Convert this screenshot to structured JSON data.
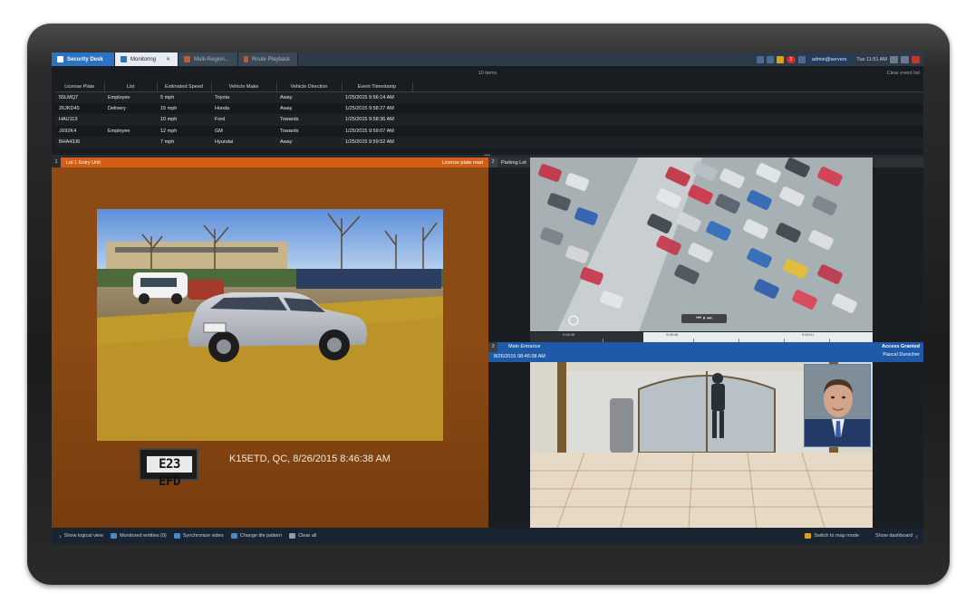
{
  "tabs": [
    {
      "label": "Security Desk"
    },
    {
      "label": "Monitoring"
    },
    {
      "label": "Multi-Region..."
    },
    {
      "label": "Route Playback"
    }
  ],
  "tray": {
    "alert_count": "3",
    "user": "admin@servers",
    "time": "Tue 11:51 AM"
  },
  "events": {
    "count_label": "10 items",
    "clear_label": "Clear event list",
    "columns": [
      "License Plate",
      "List",
      "Estimated Speed",
      "Vehicle Make",
      "Vehicle Direction",
      "Event Timestamp"
    ],
    "rows": [
      [
        "55LMQ7",
        "Employee",
        "5 mph",
        "Toyota",
        "Away",
        "1/25/2015 9:56:14 AM"
      ],
      [
        "26JKD45",
        "Delivery",
        "15 mph",
        "Honda",
        "Away",
        "1/25/2015 9:58:27 AM"
      ],
      [
        "HAU113",
        "",
        "10 mph",
        "Ford",
        "Towards",
        "1/25/2015 9:58:36 AM"
      ],
      [
        "JX92K4",
        "Employee",
        "12 mph",
        "GM",
        "Towards",
        "1/25/2015 9:59:07 AM"
      ],
      [
        "BHA43J6",
        "",
        "7 mph",
        "Hyundai",
        "Away",
        "1/25/2015 9:59:52 AM"
      ]
    ]
  },
  "tile1": {
    "num": "1",
    "title": "Lot 1 Entry Unit",
    "right_label": "License plate read",
    "plate_text": "E23 EFD",
    "read_text": "K15ETD, QC, 8/26/2015 8:46:38 AM"
  },
  "tile2": {
    "num": "2",
    "title": "Parking Lot",
    "times": [
      "9:08:46",
      "9:08:48",
      "9:09:01"
    ]
  },
  "tile3": {
    "num": "3",
    "title": "Main Entrance",
    "timestamp": "8/26/2015 08:46:38 AM",
    "status": "Access Granted",
    "person": "Pascal Durocher"
  },
  "bottom": {
    "show_logical_view": "Show logical view",
    "monitored_entities": "Monitored entities (0)",
    "synchronize_video": "Synchronize video",
    "change_tile_pattern": "Change tile pattern",
    "clear_all": "Clear all",
    "switch_map_mode": "Switch to map mode",
    "show_dashboard": "Show dashboard"
  },
  "colors": {
    "accent": "#2c73c4",
    "alarm_tile": "#d25f15",
    "access_banner": "#1f5aa8"
  }
}
